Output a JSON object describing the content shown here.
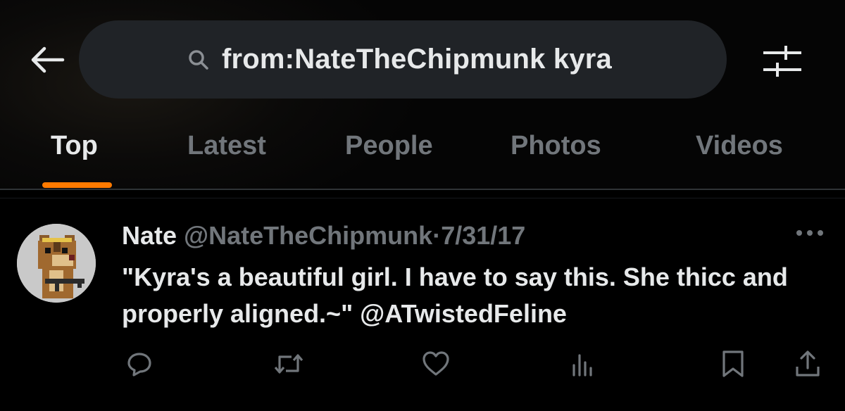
{
  "search": {
    "query": "from:NateTheChipmunk kyra"
  },
  "tabs": [
    {
      "label": "Top",
      "active": true
    },
    {
      "label": "Latest",
      "active": false
    },
    {
      "label": "People",
      "active": false
    },
    {
      "label": "Photos",
      "active": false
    },
    {
      "label": "Videos",
      "active": false
    }
  ],
  "post": {
    "author_name": "Nate",
    "author_handle": "@NateTheChipmunk",
    "separator": "·",
    "date": "7/31/17",
    "text": "\"Kyra's a beautiful girl. I have to say this. She thicc and properly aligned.~\" ",
    "mention": "@ATwistedFeline",
    "avatar_icon": "chipmunk-avatar"
  },
  "icons": {
    "back": "arrow-left-icon",
    "search": "search-icon",
    "filter": "sliders-icon",
    "more": "more-horizontal-icon",
    "reply": "reply-icon",
    "repost": "repost-icon",
    "like": "heart-icon",
    "views": "views-icon",
    "bookmark": "bookmark-icon",
    "share": "share-icon"
  },
  "colors": {
    "background": "#000000",
    "search_bg": "#202327",
    "primary_text": "#e7e9ea",
    "secondary_text": "#71767b",
    "tab_indicator": "#ff7a00",
    "divider": "#2f3336"
  }
}
